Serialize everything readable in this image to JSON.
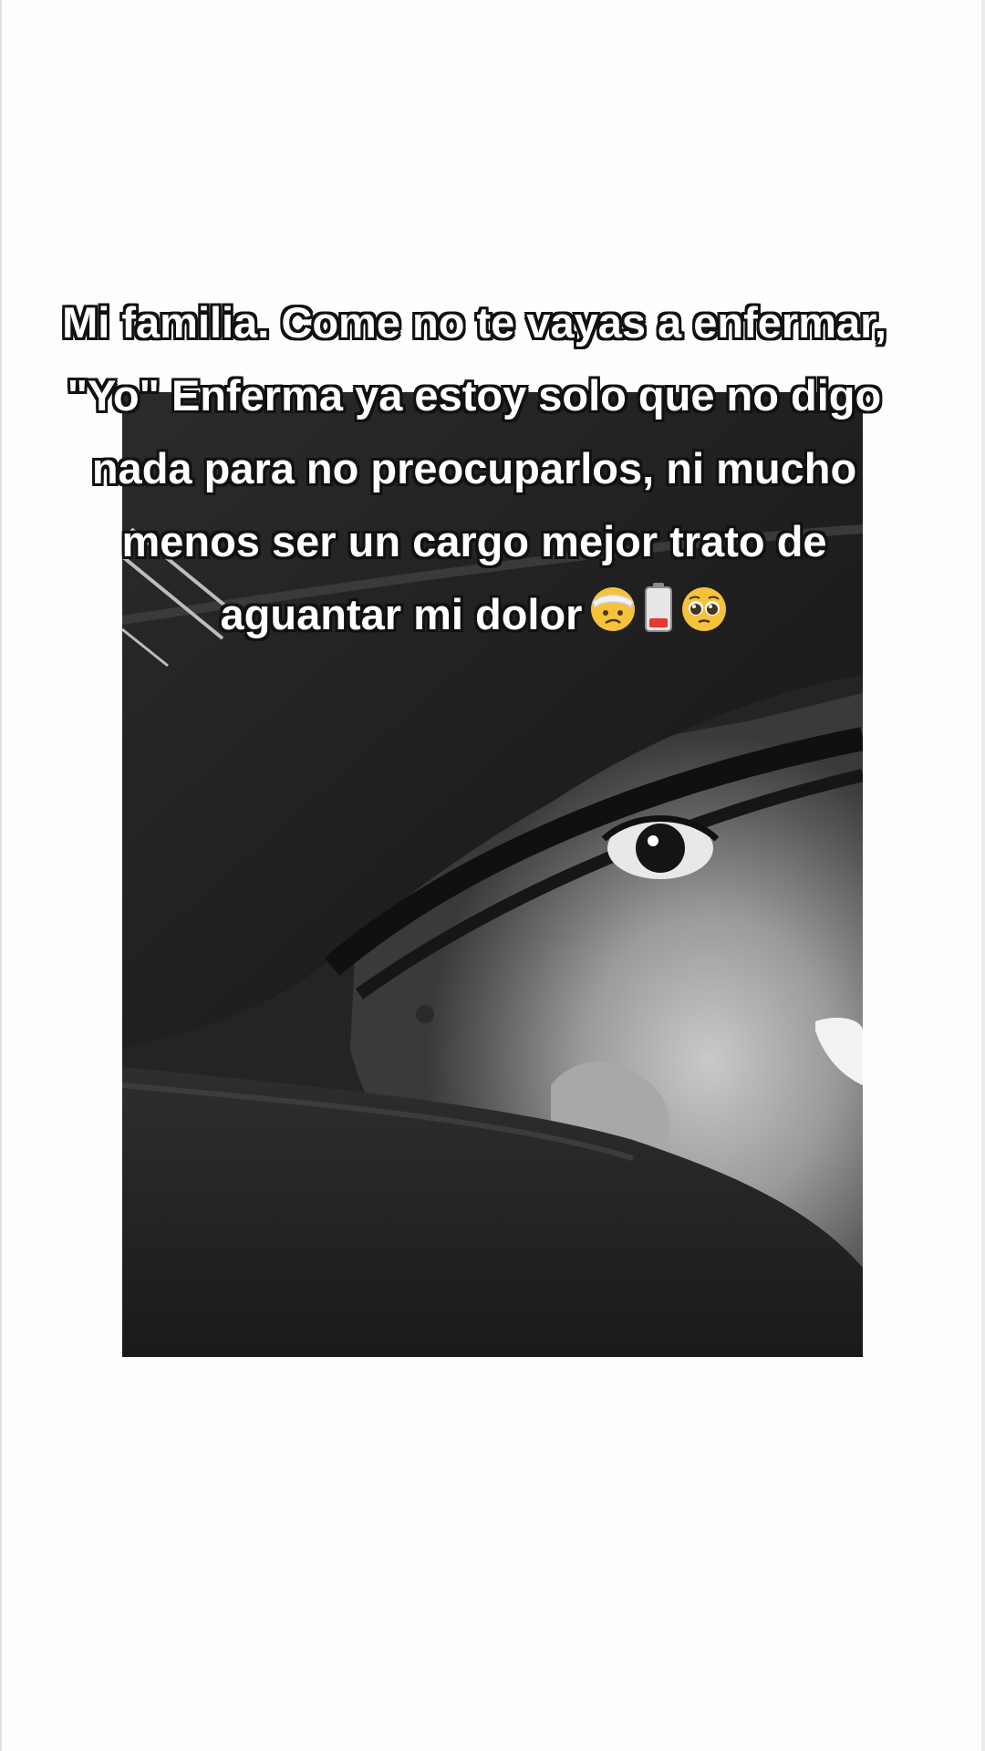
{
  "caption": {
    "lines": [
      "Mi familia. Come no te vayas a enfermar,",
      "\"Yo\"  Enferma ya estoy solo que no digo",
      "nada para no preocuparlos, ni mucho",
      "menos ser un cargo mejor trato de",
      "aguantar mi dolor"
    ],
    "emojis": [
      "bandaged-face-icon",
      "low-battery-icon",
      "pleading-face-icon"
    ]
  },
  "photo": {
    "description_colors": {
      "background": "#fefefe",
      "photo_dark": "#1c1c1c",
      "skin_mid": "#9a9a9a"
    }
  }
}
